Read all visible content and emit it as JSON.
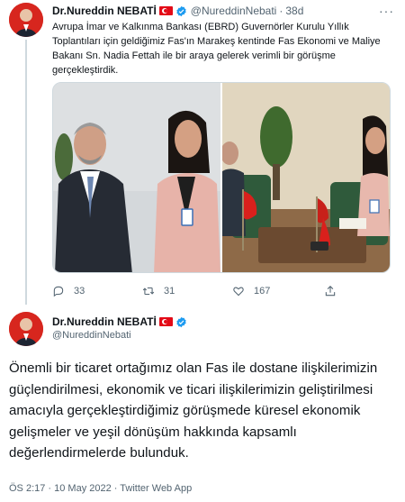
{
  "tweet1": {
    "author_name": "Dr.Nureddin NEBATİ",
    "handle": "@NureddinNebati",
    "separator": "·",
    "time": "38d",
    "text": "Avrupa İmar ve Kalkınma Bankası (EBRD) Guvernörler Kurulu Yıllık Toplantıları için geldiğimiz Fas'ın Marakeş kentinde Fas Ekonomi ve Maliye Bakanı Sn. Nadia Fettah ile bir araya gelerek verimli bir görüşme gerçekleştirdik.",
    "stats": {
      "replies": "33",
      "retweets": "31",
      "likes": "167"
    },
    "icons": [
      "reply-icon",
      "retweet-icon",
      "like-icon",
      "share-icon",
      "more-icon",
      "verified-icon",
      "turkish-flag-icon"
    ]
  },
  "tweet2": {
    "author_name": "Dr.Nureddin NEBATİ",
    "handle": "@NureddinNebati",
    "text": "Önemli bir ticaret ortağımız olan Fas ile dostane ilişkilerimizin güçlendirilmesi, ekonomik ve ticari ilişkilerimizin geliştirilmesi amacıyla gerçekleştirdiğimiz görüşmede küresel ekonomik gelişmeler ve yeşil dönüşüm hakkında kapsamlı değerlendirmelerde bulunduk.",
    "meta": "ÖS 2:17 · 10 May 2022 · Twitter Web App"
  },
  "colors": {
    "text": "#0f1419",
    "secondary": "#536471",
    "verified": "#1d9bf0",
    "flag": "#e30a17",
    "divider": "#cfd9de"
  }
}
